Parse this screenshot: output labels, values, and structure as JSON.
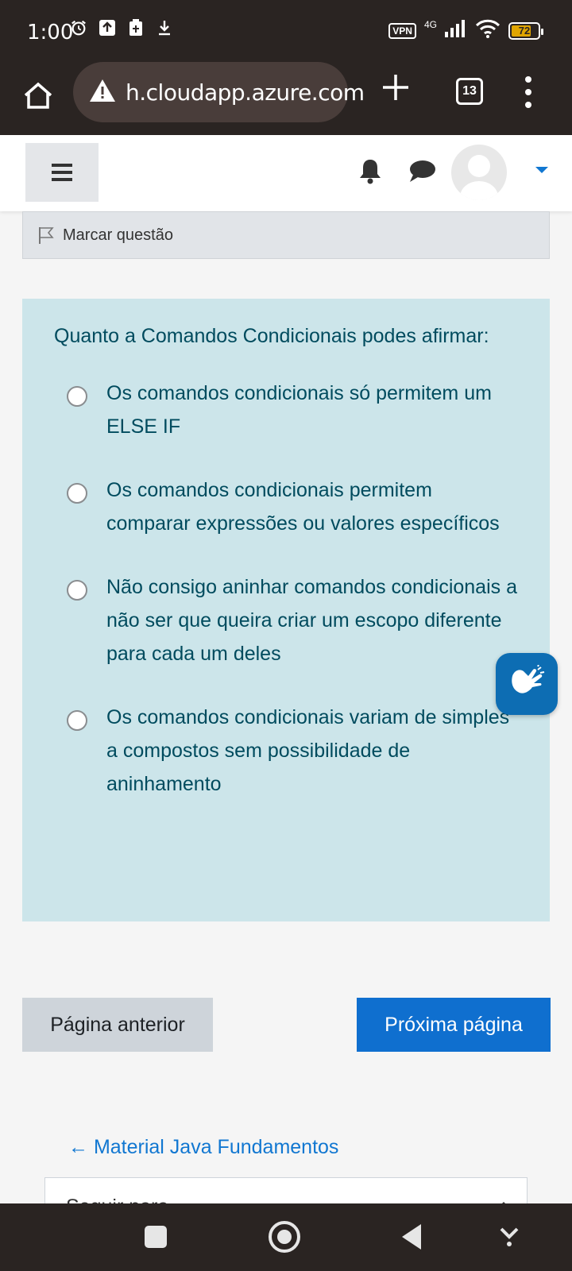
{
  "status_bar": {
    "time": "1:00",
    "vpn": "VPN",
    "network": "4G",
    "battery": "72"
  },
  "browser": {
    "url": "h.cloudapp.azure.com",
    "tab_count": "13"
  },
  "quiz": {
    "flag_label": "Marcar questão",
    "question": "Quanto a Comandos Condicionais podes afirmar:",
    "answers": [
      "Os comandos condicionais só permitem um ELSE IF",
      "Os comandos condicionais permitem comparar expressões ou valores específicos",
      "Não consigo aninhar comandos condicionais a não ser que queira criar um escopo diferente para cada um deles",
      "Os comandos condicionais variam de simples a compostos sem possibilidade de aninhamento"
    ],
    "prev_button": "Página anterior",
    "next_button": "Próxima página",
    "activity_link": "← Material Java Fundamentos",
    "jump_to": "Seguir para..."
  },
  "colors": {
    "question_bg": "#cce5ea",
    "question_text": "#004b5e",
    "primary": "#0f6fcf",
    "chrome_dark": "#2a2422"
  }
}
